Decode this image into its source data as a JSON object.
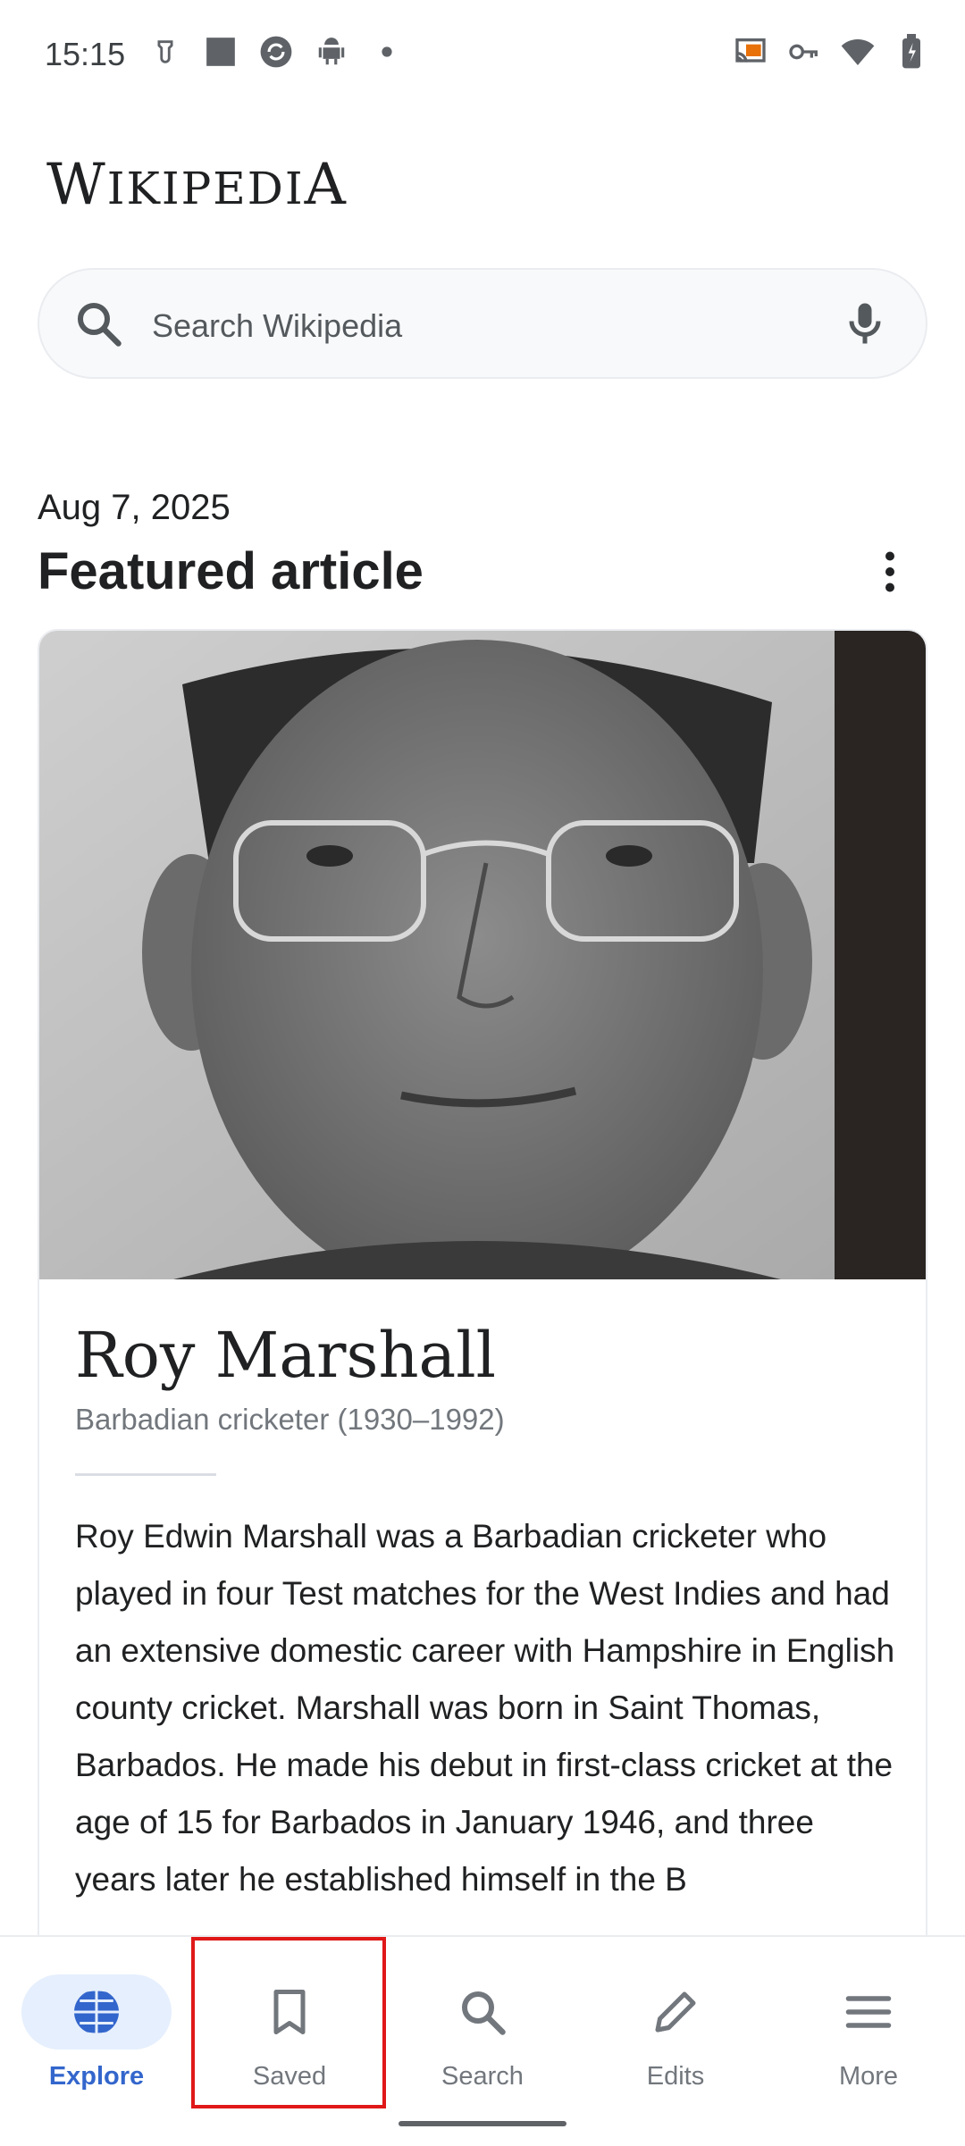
{
  "status_bar": {
    "time": "15:15"
  },
  "logo": {
    "first": "W",
    "rest": "IKIPEDI",
    "last": "A"
  },
  "search": {
    "placeholder": "Search Wikipedia"
  },
  "feed": {
    "date": "Aug 7, 2025",
    "section_title": "Featured article"
  },
  "article": {
    "title": "Roy Marshall",
    "subtitle": "Barbadian cricketer (1930–1992)",
    "body": "Roy Edwin Marshall was a Barbadian cricketer who played in four Test matches for the West Indies and had an extensive domestic career with Hampshire in English county cricket. Marshall was born in Saint Thomas, Barbados. He made his debut in first-class cricket at the age of 15 for Barbados in January 1946, and three years later he established himself in the B"
  },
  "bottom_nav": {
    "explore": "Explore",
    "saved": "Saved",
    "search": "Search",
    "edits": "Edits",
    "more": "More"
  },
  "colors": {
    "accent": "#3366cc",
    "active_pill": "#e6effd",
    "highlight": "#e01818"
  }
}
